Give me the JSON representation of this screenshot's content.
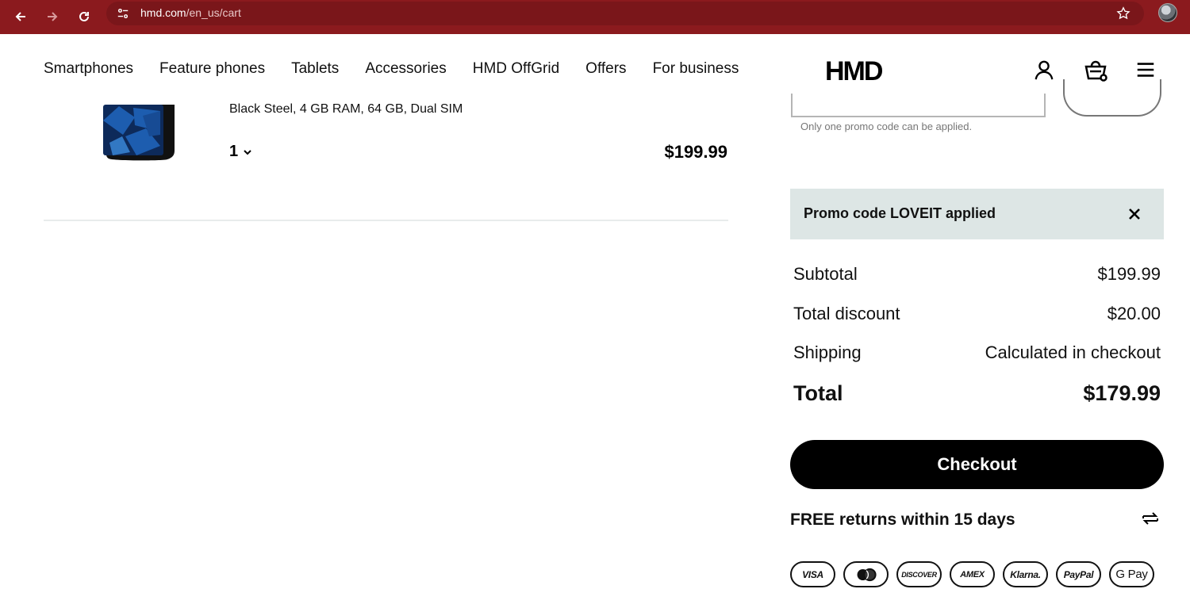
{
  "browser": {
    "url_host": "hmd.com",
    "url_path": "/en_us/cart"
  },
  "header": {
    "nav": [
      "Smartphones",
      "Feature phones",
      "Tablets",
      "Accessories",
      "HMD OffGrid",
      "Offers",
      "For business"
    ],
    "logo": "HMD"
  },
  "cart": {
    "item": {
      "variant": "Black Steel, 4 GB RAM, 64 GB, Dual SIM",
      "quantity": "1",
      "price": "$199.99"
    }
  },
  "promo": {
    "note": "Only one promo code can be applied.",
    "applied_text": "Promo code LOVEIT applied"
  },
  "summary": {
    "subtotal_label": "Subtotal",
    "subtotal_value": "$199.99",
    "discount_label": "Total discount",
    "discount_value": "$20.00",
    "shipping_label": "Shipping",
    "shipping_value": "Calculated in checkout",
    "total_label": "Total",
    "total_value": "$179.99"
  },
  "checkout_label": "Checkout",
  "returns_text": "FREE returns within 15 days",
  "payments": [
    "VISA",
    "mastercard-icon",
    "DISCOVER",
    "AMEX",
    "Klarna.",
    "PayPal",
    "G Pay"
  ],
  "colors": {
    "browser_bar": "#8b1a1e",
    "promo_banner": "#dde6e5",
    "checkout_bg": "#000000"
  }
}
